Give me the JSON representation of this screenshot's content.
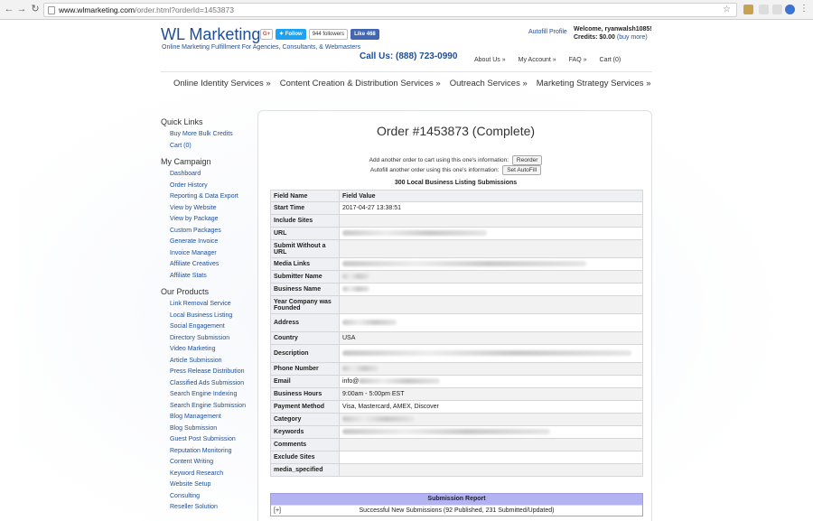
{
  "browser": {
    "url_host": "www.wlmarketing.com",
    "url_path": "/order.html?orderId=1453873"
  },
  "header": {
    "logo": "WL Marketing",
    "tagline": "Online Marketing Fulfillment For Agencies, Consultants, & Webmasters",
    "gplus": "G+",
    "twitter_label": "Follow",
    "twitter_count": "944 followers",
    "facebook_label": "Like 468",
    "autofill_profile": "Autofill Profile",
    "welcome": "Welcome, ryanwalsh1085!",
    "credits": "Credits: $0.00",
    "buy_more": "(buy more)",
    "call_us": "Call Us: (888) 723-0990",
    "top_links": [
      "About Us »",
      "My Account »",
      "FAQ »",
      "Cart (0)"
    ]
  },
  "main_nav": [
    "Online Identity Services »",
    "Content Creation & Distribution Services »",
    "Outreach Services »",
    "Marketing Strategy Services »"
  ],
  "sidebar": {
    "quick_links_title": "Quick Links",
    "quick_links": [
      "Buy More Bulk Credits",
      "Cart (0)"
    ],
    "campaign_title": "My Campaign",
    "campaign": [
      "Dashboard",
      "Order History",
      "Reporting & Data Export",
      "View by Website",
      "View by Package",
      "Custom Packages",
      "Generate Invoice",
      "Invoice Manager",
      "Affiliate Creatives",
      "Affiliate Stats"
    ],
    "products_title": "Our Products",
    "products": [
      "Link Removal Service",
      "Local Business Listing",
      "Social Engagement",
      "Directory Submission",
      "Video Marketing",
      "Article Submission",
      "Press Release Distribution",
      "Classified Ads Submission",
      "Search Engine Indexing",
      "Search Engine Submission",
      "Blog Management",
      "Blog Submission",
      "Guest Post Submission",
      "Reputation Monitoring",
      "Content Writing",
      "Keyword Research",
      "Website Setup",
      "Consulting",
      "Reseller Solution"
    ]
  },
  "order": {
    "title": "Order #1453873 (Complete)",
    "reorder_text": "Add another order to cart using this one's information:",
    "reorder_button": "Reorder",
    "autofill_text": "Autofill another order using this one's information:",
    "autofill_button": "Set AutoFill",
    "listing_title": "300 Local Business Listing Submissions"
  },
  "fields_table": {
    "header": [
      "Field Name",
      "Field Value"
    ],
    "rows": [
      {
        "name": "Start Time",
        "value": "2017-04-27 13:38:51"
      },
      {
        "name": "Include Sites",
        "value": ""
      },
      {
        "name": "URL",
        "value": ""
      },
      {
        "name": "Submit Without a URL",
        "value": ""
      },
      {
        "name": "Media Links",
        "value": ""
      },
      {
        "name": "Submitter Name",
        "value": ""
      },
      {
        "name": "Business Name",
        "value": ""
      },
      {
        "name": "Year Company was Founded",
        "value": ""
      },
      {
        "name": "Address",
        "value": ""
      },
      {
        "name": "Country",
        "value": "USA"
      },
      {
        "name": "Description",
        "value": ""
      },
      {
        "name": "Phone Number",
        "value": ""
      },
      {
        "name": "Email",
        "value": "info@"
      },
      {
        "name": "Business Hours",
        "value": "9:00am - 5:00pm EST"
      },
      {
        "name": "Payment Method",
        "value": "Visa, Mastercard, AMEX, Discover"
      },
      {
        "name": "Category",
        "value": ""
      },
      {
        "name": "Keywords",
        "value": ""
      },
      {
        "name": "Comments",
        "value": ""
      },
      {
        "name": "Exclude Sites",
        "value": ""
      },
      {
        "name": "media_specified",
        "value": ""
      }
    ]
  },
  "report": {
    "title": "Submission Report",
    "toggle": "[+]",
    "summary": "Successful New Submissions (92 Published, 231 Submitted/Updated)"
  }
}
